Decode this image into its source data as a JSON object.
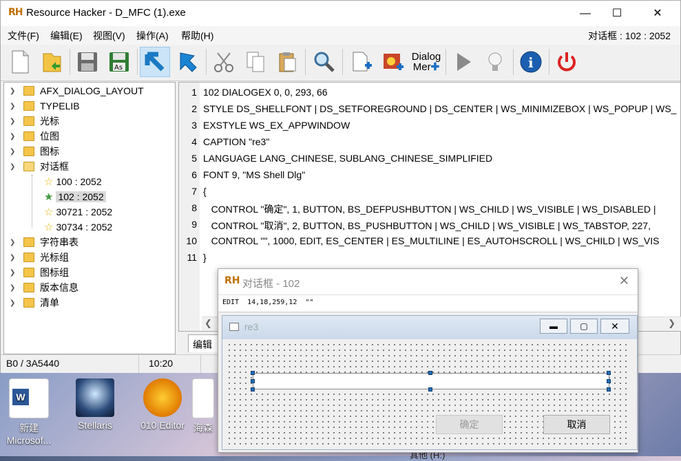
{
  "window": {
    "title": "Resource Hacker - D_MFC (1).exe",
    "logo": "RH",
    "minimize": "—",
    "maximize": "☐",
    "close": "✕"
  },
  "menu": {
    "items": [
      "文件(F)",
      "编辑(E)",
      "视图(V)",
      "操作(A)",
      "帮助(H)"
    ],
    "right_status": "对话框 : 102 : 2052"
  },
  "toolbar": {
    "dialog_merge_label_1": "Dialog",
    "dialog_merge_label_2": "Mer"
  },
  "tree": {
    "items": [
      {
        "label": "AFX_DIALOG_LAYOUT"
      },
      {
        "label": "TYPELIB"
      },
      {
        "label": "光标"
      },
      {
        "label": "位图"
      },
      {
        "label": "图标"
      },
      {
        "label": "对话框"
      },
      {
        "label": "100 : 2052"
      },
      {
        "label": "102 : 2052"
      },
      {
        "label": "30721 : 2052"
      },
      {
        "label": "30734 : 2052"
      },
      {
        "label": "字符串表"
      },
      {
        "label": "光标组"
      },
      {
        "label": "图标组"
      },
      {
        "label": "版本信息"
      },
      {
        "label": "清单"
      }
    ]
  },
  "editor": {
    "lines": [
      "102 DIALOGEX 0, 0, 293, 66",
      "STYLE DS_SHELLFONT | DS_SETFOREGROUND | DS_CENTER | WS_MINIMIZEBOX | WS_POPUP | WS_",
      "EXSTYLE WS_EX_APPWINDOW",
      "CAPTION \"re3\"",
      "LANGUAGE LANG_CHINESE, SUBLANG_CHINESE_SIMPLIFIED",
      "FONT 9, \"MS Shell Dlg\"",
      "{",
      "   CONTROL \"确定\", 1, BUTTON, BS_DEFPUSHBUTTON | WS_CHILD | WS_VISIBLE | WS_DISABLED |",
      "   CONTROL \"取消\", 2, BUTTON, BS_PUSHBUTTON | WS_CHILD | WS_VISIBLE | WS_TABSTOP, 227,",
      "   CONTROL \"\", 1000, EDIT, ES_CENTER | ES_MULTILINE | ES_AUTOHSCROLL | WS_CHILD | WS_VIS",
      "}"
    ],
    "tab_label": "编辑器"
  },
  "status": {
    "offset": "B0 / 3A5440",
    "position": "10:20"
  },
  "dialog_preview": {
    "title": "对话框 - 102",
    "info": "EDIT  14,18,259,12  \"\"",
    "caption": "re3",
    "ok_label": "确定",
    "cancel_label": "取消"
  },
  "desktop": {
    "icons": [
      {
        "label": "新建\nMicrosof..."
      },
      {
        "label": "Stellaris"
      },
      {
        "label": "010 Editor"
      },
      {
        "label": "海森"
      }
    ],
    "behind_text": "其他 (H:)"
  }
}
